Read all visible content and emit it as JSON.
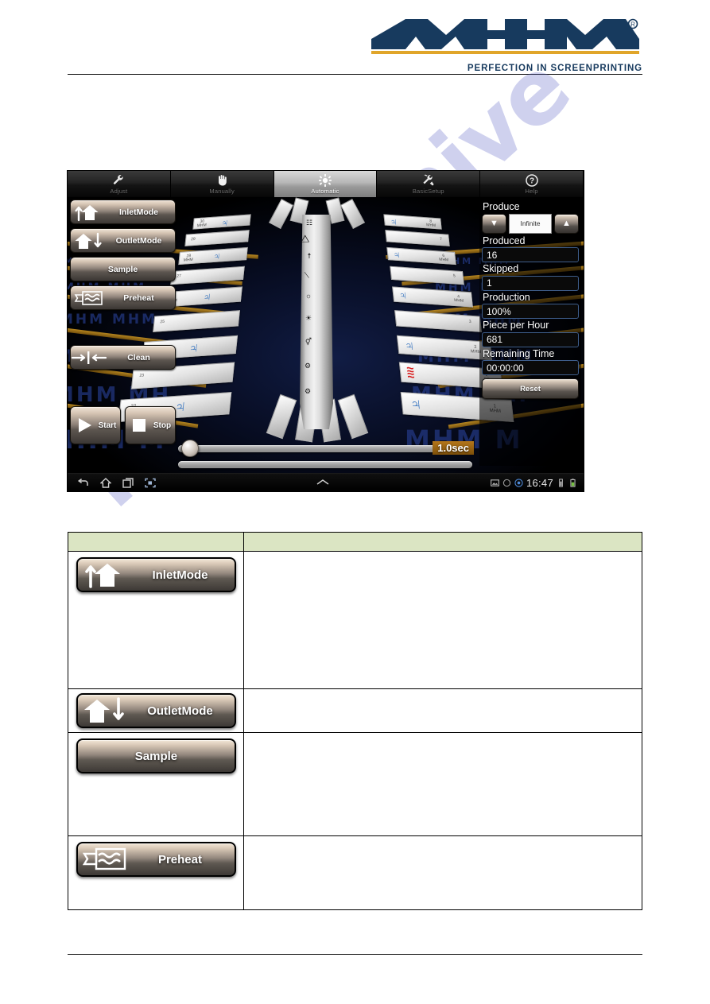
{
  "header": {
    "logo_text": "MHM",
    "logo_registered": "®",
    "tagline": "PERFECTION IN SCREENPRINTING"
  },
  "watermark": {
    "text": "manualshive"
  },
  "tablet": {
    "tabs": [
      {
        "label": "Adjust",
        "icon": "wrench-icon",
        "active": false
      },
      {
        "label": "Manually",
        "icon": "hand-icon",
        "active": false
      },
      {
        "label": "Automatic",
        "icon": "gear-sun-icon",
        "active": true
      },
      {
        "label": "BasicSetup",
        "icon": "tools-icon",
        "active": false
      },
      {
        "label": "Help",
        "icon": "question-circle-icon",
        "active": false
      }
    ],
    "left_buttons": [
      {
        "label": "InletMode",
        "icon": "inlet-arrows-icon"
      },
      {
        "label": "OutletMode",
        "icon": "outlet-arrows-icon"
      },
      {
        "label": "Sample",
        "icon": ""
      },
      {
        "label": "Preheat",
        "icon": "preheat-waves-icon"
      },
      {
        "label": "Clean",
        "icon": "clean-arrows-icon"
      }
    ],
    "start_button": {
      "label": "Start",
      "icon": "play-icon"
    },
    "stop_button": {
      "label": "Stop",
      "icon": "stop-square-icon"
    },
    "right_panel": {
      "produce_label": "Produce",
      "produce_down": "▼",
      "produce_value": "Infinite",
      "produce_up": "▲",
      "produced_label": "Produced",
      "produced_value": "16",
      "skipped_label": "Skipped",
      "skipped_value": "1",
      "production_label": "Production",
      "production_value": "100%",
      "pieces_label": "Piece per Hour",
      "pieces_value": "681",
      "remaining_label": "Remaining Time",
      "remaining_value": "00:00:00",
      "reset_label": "Reset"
    },
    "slider": {
      "time_badge": "1.0sec"
    },
    "navbar": {
      "back": "back-icon",
      "home": "home-icon",
      "recents": "recents-icon",
      "screenshot": "screenshot-icon",
      "expand": "chevron-up-icon",
      "clock": "16:47"
    }
  },
  "table": {
    "header": {
      "col1": "",
      "col2": ""
    },
    "rows": [
      {
        "button_label": "InletMode",
        "icon": "inlet-arrows-icon",
        "description": ""
      },
      {
        "button_label": "OutletMode",
        "icon": "outlet-arrows-icon",
        "description": ""
      },
      {
        "button_label": "Sample",
        "icon": "",
        "description": ""
      },
      {
        "button_label": "Preheat",
        "icon": "preheat-waves-icon",
        "description": ""
      }
    ]
  },
  "colors": {
    "brand_navy": "#173a5e",
    "brand_gold": "#e0a52a",
    "table_header_green": "#dbe5c3",
    "accent_orange": "#b4761a"
  }
}
